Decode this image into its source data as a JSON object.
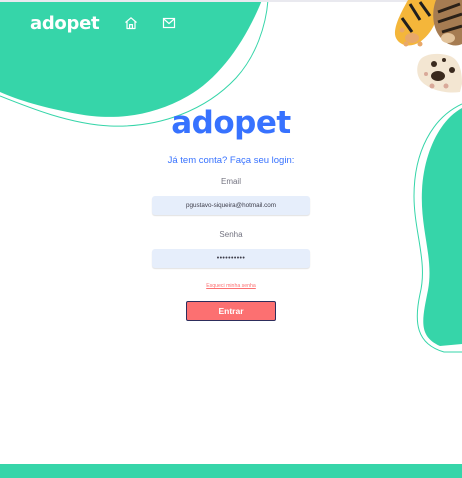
{
  "header": {
    "logo_text": "adopet",
    "nav": [
      {
        "icon": "home-icon"
      },
      {
        "icon": "mail-icon"
      }
    ]
  },
  "main": {
    "logo_text": "adopet",
    "subtitle": "Já tem conta? Faça seu login:",
    "email_label": "Email",
    "email_value": "pgustavo-siqueira@hotmail.com",
    "password_label": "Senha",
    "password_value": "••••••••••",
    "forgot_link": "Esqueci minha senha",
    "submit_label": "Entrar"
  },
  "colors": {
    "accent_green": "#36d5a9",
    "brand_blue": "#3772ff",
    "coral": "#fc7071",
    "input_bg": "#e6eefb"
  }
}
